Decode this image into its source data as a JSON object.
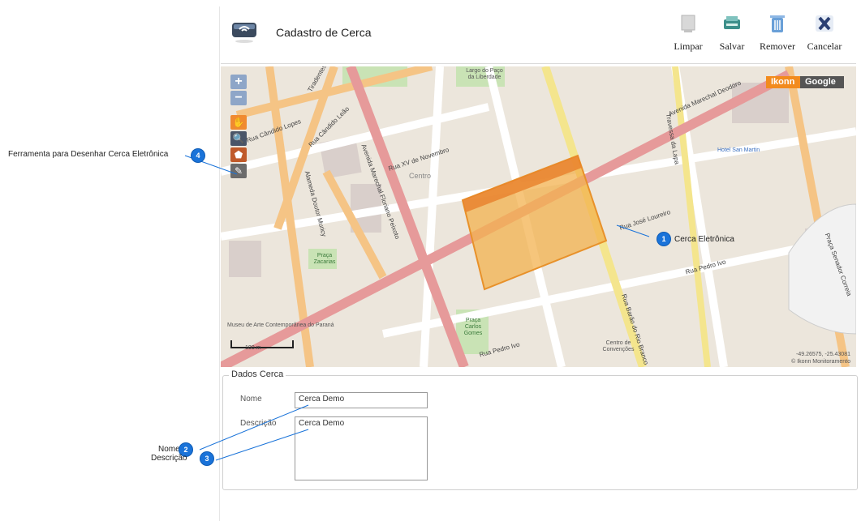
{
  "header": {
    "title": "Cadastro de Cerca",
    "buttons": [
      {
        "label": "Limpar",
        "icon": "clear-icon"
      },
      {
        "label": "Salvar",
        "icon": "save-icon"
      },
      {
        "label": "Remover",
        "icon": "trash-icon"
      },
      {
        "label": "Cancelar",
        "icon": "cancel-x-icon"
      }
    ]
  },
  "map": {
    "zoom_in": "+",
    "zoom_out": "−",
    "providers": [
      "Ikonn",
      "Google"
    ],
    "scale_label": "100 m",
    "coords": "-49.26575, -25.43081",
    "attribution": "© Ikonn Monitoramento",
    "places": {
      "centro": "Centro",
      "paco_liberdade": "Largo do Paço da Liberdade",
      "praca_zacarias": "Praça Zacarias",
      "praca_carlos_gomes": "Praça Carlos Gomes",
      "museu": "Museu de Arte Contemporânea do Paraná",
      "centro_convencoes": "Centro de Convenções",
      "hotel": "Hotel San Martin"
    },
    "streets": {
      "xv_novembro": "Rua XV de Novembro",
      "candido_lopes": "Rua Cândido Lopes",
      "candido_leao": "Rua Cândido Leão",
      "jose_loureiro": "Rua José Loureiro",
      "pedro_ivo": "Rua Pedro Ivo",
      "pedro_ivo_2": "Rua Pedro Ivo",
      "marechal_deodoro": "Avenida Marechal Deodoro",
      "marechal_floriano": "Avenida Marechal Floriano Peixoto",
      "travessa_lapa": "Travessa da Lapa",
      "dr_muricy": "Alameda Doutor Muricy",
      "barao_rio_branco": "Rua Barão do Rio Branco",
      "senador_correia": "Praça Senador Correia",
      "tradentes": "Tiradentes"
    }
  },
  "form": {
    "legend": "Dados Cerca",
    "nome_label": "Nome",
    "nome_value": "Cerca Demo",
    "descricao_label": "Descrição",
    "descricao_value": "Cerca Demo"
  },
  "callouts": [
    {
      "number": "1",
      "text": "Cerca Eletrônica"
    },
    {
      "number": "2",
      "text": "Nome"
    },
    {
      "number": "3",
      "text": "Descrição"
    },
    {
      "number": "4",
      "text": "Ferramenta para Desenhar Cerca Eletrônica"
    }
  ],
  "colors": {
    "fence_fill": "#f3b24f",
    "callout_blue": "#1a73d9",
    "ikonn_orange": "#f28b1e",
    "road_main": "#e69a9a",
    "road_secondary": "#f5c485",
    "road_yellow": "#f4e58d"
  }
}
